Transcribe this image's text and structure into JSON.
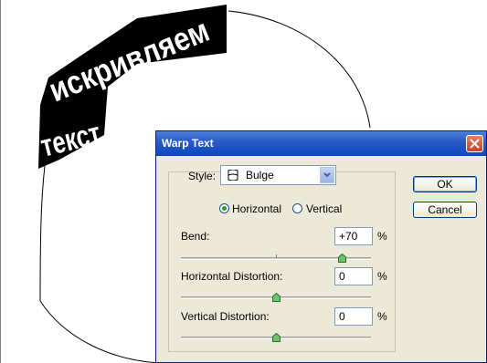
{
  "canvas": {
    "warped_line1": "искривляем",
    "warped_line2": "текст"
  },
  "dialog": {
    "title": "Warp Text",
    "style_label": "Style:",
    "style_value": "Bulge",
    "orientation_horizontal": "Horizontal",
    "orientation_vertical": "Vertical",
    "orientation_selected": "Horizontal",
    "bend_label": "Bend:",
    "bend_value": "+70",
    "bend_level": 70,
    "horizontal_distortion_label": "Horizontal Distortion:",
    "horizontal_distortion_value": "0",
    "vertical_distortion_label": "Vertical Distortion:",
    "vertical_distortion_value": "0",
    "percent_sign": "%",
    "ok_label": "OK",
    "cancel_label": "Cancel"
  },
  "colors": {
    "title_bar": "#0a47c0",
    "dialog_bg": "#ece9d8",
    "close_button": "#c3432a",
    "warp_fill": "#000000"
  }
}
